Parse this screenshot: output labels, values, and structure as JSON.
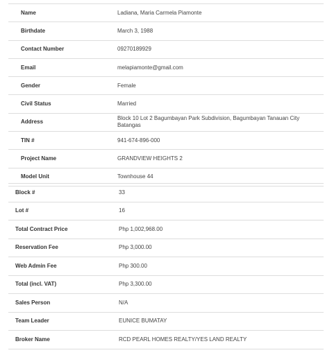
{
  "personal_info": [
    {
      "label": "Name",
      "value": "Ladiana, Maria Carmela Piamonte"
    },
    {
      "label": "Birthdate",
      "value": "March 3, 1988"
    },
    {
      "label": "Contact Number",
      "value": "09270189929"
    },
    {
      "label": "Email",
      "value": "melapiamonte@gmail.com"
    },
    {
      "label": "Gender",
      "value": "Female"
    },
    {
      "label": "Civil Status",
      "value": "Married"
    },
    {
      "label": "Address",
      "value": "Block 10 Lot 2 Bagumbayan Park Subdivision, Bagumbayan Tanauan City Batangas"
    },
    {
      "label": "TIN #",
      "value": "941-674-896-000"
    },
    {
      "label": "Project Name",
      "value": "GRANDVIEW HEIGHTS 2"
    },
    {
      "label": "Model Unit",
      "value": "Townhouse 44"
    }
  ],
  "contract_info": [
    {
      "label": "Block #",
      "value": "33"
    },
    {
      "label": "Lot #",
      "value": "16"
    },
    {
      "label": "Total Contract Price",
      "value": "Php 1,002,968.00"
    },
    {
      "label": "Reservation Fee",
      "value": "Php 3,000.00"
    },
    {
      "label": "Web Admin Fee",
      "value": "Php 300.00"
    },
    {
      "label": "Total (incl. VAT)",
      "value": "Php 3,300.00"
    },
    {
      "label": "Sales Person",
      "value": "N/A"
    },
    {
      "label": "Team Leader",
      "value": "EUNICE BUMATAY"
    },
    {
      "label": "Broker Name",
      "value": "RCD PEARL HOMES REALTY/YES LAND REALTY"
    }
  ]
}
